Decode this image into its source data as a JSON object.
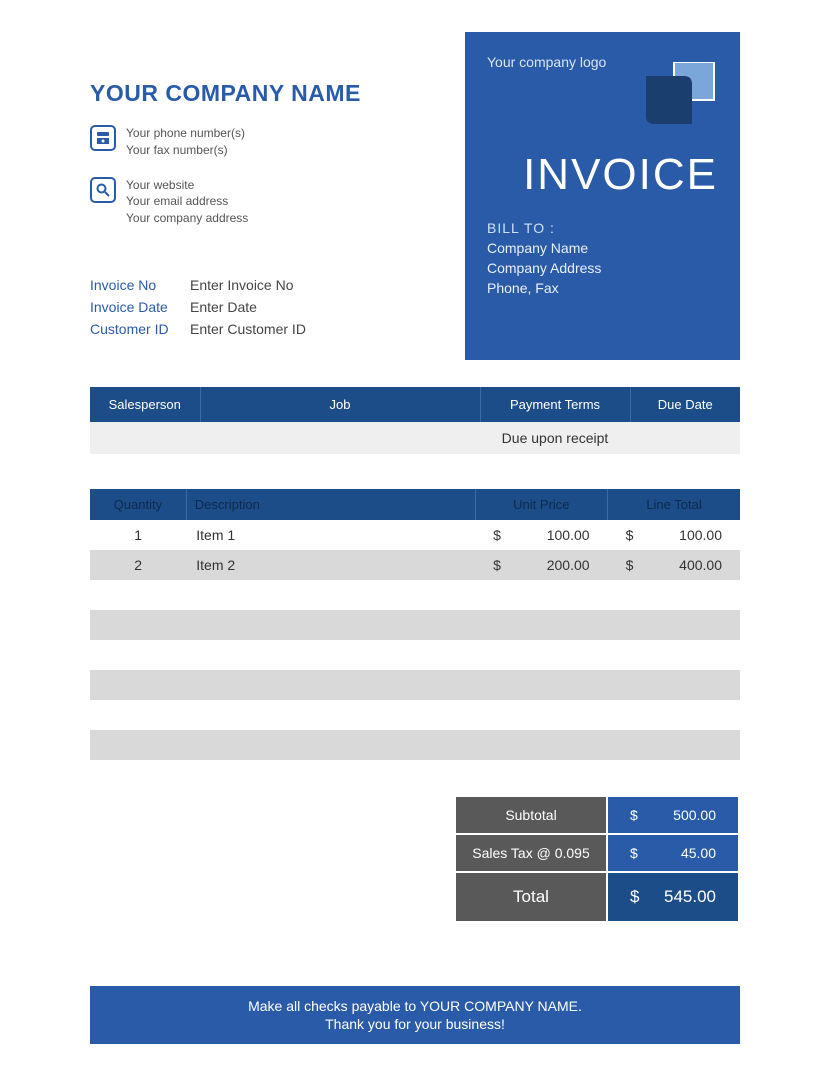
{
  "header": {
    "company_name": "YOUR COMPANY NAME",
    "phone_label": "Your phone number(s)",
    "fax_label": "Your fax number(s)",
    "website_label": "Your website",
    "email_label": "Your email address",
    "address_label": "Your company address"
  },
  "logo_box": {
    "logo_label": "Your company logo",
    "title": "INVOICE",
    "bill_to_label": "BILL TO :",
    "company": "Company Name",
    "address": "Company Address",
    "phone": "Phone, Fax"
  },
  "meta": {
    "invoice_no_label": "Invoice No",
    "invoice_no_value": "Enter Invoice No",
    "invoice_date_label": "Invoice Date",
    "invoice_date_value": "Enter Date",
    "customer_id_label": "Customer ID",
    "customer_id_value": "Enter Customer ID"
  },
  "order": {
    "headers": [
      "Salesperson",
      "Job",
      "Payment Terms",
      "Due Date"
    ],
    "row": {
      "salesperson": "",
      "job": "",
      "terms": "Due upon receipt",
      "due": ""
    }
  },
  "items": {
    "headers": [
      "Quantity",
      "Description",
      "Unit Price",
      "Line Total"
    ],
    "currency": "$",
    "rows": [
      {
        "qty": "1",
        "desc": "Item 1",
        "price": "100.00",
        "total": "100.00"
      },
      {
        "qty": "2",
        "desc": "Item 2",
        "price": "200.00",
        "total": "400.00"
      }
    ],
    "empty_rows": 6
  },
  "totals": {
    "subtotal_label": "Subtotal",
    "subtotal": "500.00",
    "tax_label": "Sales Tax @ 0.095",
    "tax": "45.00",
    "total_label": "Total",
    "total": "545.00",
    "currency": "$"
  },
  "footer": {
    "line1": "Make all checks payable to YOUR COMPANY NAME.",
    "line2": "Thank you for your business!"
  }
}
